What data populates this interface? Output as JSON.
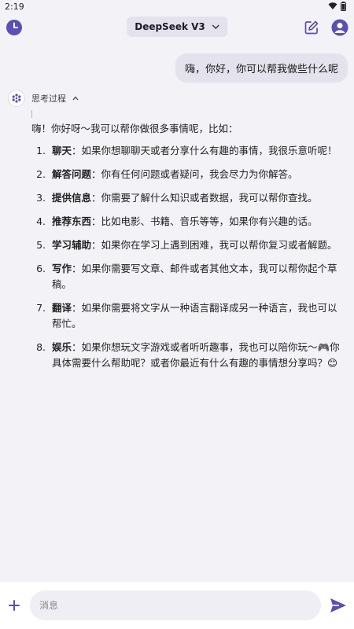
{
  "statusbar": {
    "time": "2:19"
  },
  "header": {
    "model_label": "DeepSeek V3"
  },
  "user_message": "嗨，你好，你可以帮我做些什么呢",
  "thinking": {
    "label": "思考过程",
    "toggle": "^"
  },
  "answer": {
    "intro": "嗨！你好呀～我可以帮你做很多事情呢，比如：",
    "items": [
      {
        "num": "1.",
        "term": "聊天",
        "text": "：如果你想聊聊天或者分享什么有趣的事情，我很乐意听呢！"
      },
      {
        "num": "2.",
        "term": "解答问题",
        "text": "：你有任何问题或者疑问，我会尽力为你解答。"
      },
      {
        "num": "3.",
        "term": "提供信息",
        "text": "：你需要了解什么知识或者数据，我可以帮你查找。"
      },
      {
        "num": "4.",
        "term": "推荐东西",
        "text": "：比如电影、书籍、音乐等等，如果你有兴趣的话。"
      },
      {
        "num": "5.",
        "term": "学习辅助",
        "text": "：如果你在学习上遇到困难，我可以帮你复习或者解题。"
      },
      {
        "num": "6.",
        "term": "写作",
        "text": "：如果你需要写文章、邮件或者其他文本，我可以帮你起个草稿。"
      },
      {
        "num": "7.",
        "term": "翻译",
        "text": "：如果你需要将文字从一种语言翻译成另一种语言，我也可以帮忙。"
      },
      {
        "num": "8.",
        "term": "娱乐",
        "text": "：如果你想玩文字游戏或者听听趣事，我也可以陪你玩～🎮你具体需要什么帮助呢？或者你最近有什么有趣的事情想分享吗？😊"
      }
    ]
  },
  "composer": {
    "placeholder": "消息"
  },
  "colors": {
    "accent": "#5a4fb2",
    "background": "#f3f2f7"
  }
}
